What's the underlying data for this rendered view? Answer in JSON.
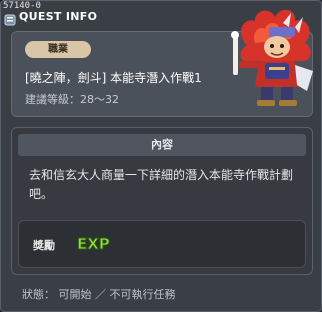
{
  "window": {
    "id_tag": "57140-0",
    "title": "QUEST INFO"
  },
  "job": {
    "badge": "職業",
    "quest_name": "[曉之陣，劍斗] 本能寺潛入作戰1",
    "level_requirement": "建議等級：28～32"
  },
  "content": {
    "header": "內容",
    "description": "去和信玄大人商量一下詳細的潛入本能寺作戰計劃吧。"
  },
  "reward": {
    "label": "獎勵",
    "exp_text": "EXP"
  },
  "status": {
    "text": "狀態： 可開始 ／ 不可執行任務"
  },
  "colors": {
    "badge_bg": "#d8c6a6",
    "exp_green": "#9ae03c",
    "panel_bg": "#4b515a"
  }
}
